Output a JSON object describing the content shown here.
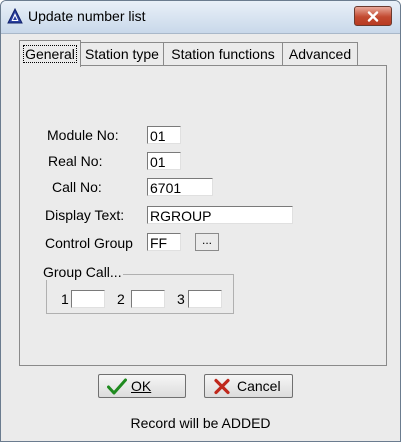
{
  "window": {
    "title": "Update number list",
    "close_label": "Close"
  },
  "tabs": [
    {
      "label": "General",
      "active": true
    },
    {
      "label": "Station type",
      "active": false
    },
    {
      "label": "Station functions",
      "active": false
    },
    {
      "label": "Advanced",
      "active": false
    }
  ],
  "form": {
    "module_no_label": "Module No:",
    "module_no_value": "01",
    "real_no_label": "Real No:",
    "real_no_value": "01",
    "call_no_label": "Call No:",
    "call_no_value": "6701",
    "display_text_label": "Display Text:",
    "display_text_value": "RGROUP",
    "control_group_label": "Control Group",
    "control_group_value": "FF",
    "control_group_browse": "...",
    "group_call_title": "Group Call...",
    "group_call_1_label": "1",
    "group_call_1_value": "",
    "group_call_2_label": "2",
    "group_call_2_value": "",
    "group_call_3_label": "3",
    "group_call_3_value": ""
  },
  "buttons": {
    "ok_label": "OK",
    "cancel_label": "Cancel"
  },
  "status": {
    "text": "Record will be ADDED"
  },
  "icons": {
    "app": "app-pyramid-icon",
    "close": "close-x-icon",
    "ok": "green-check-icon",
    "cancel": "red-x-icon"
  },
  "colors": {
    "close_button": "#c24a31",
    "ok_check": "#1f8a1f",
    "cancel_x": "#c0281c"
  }
}
